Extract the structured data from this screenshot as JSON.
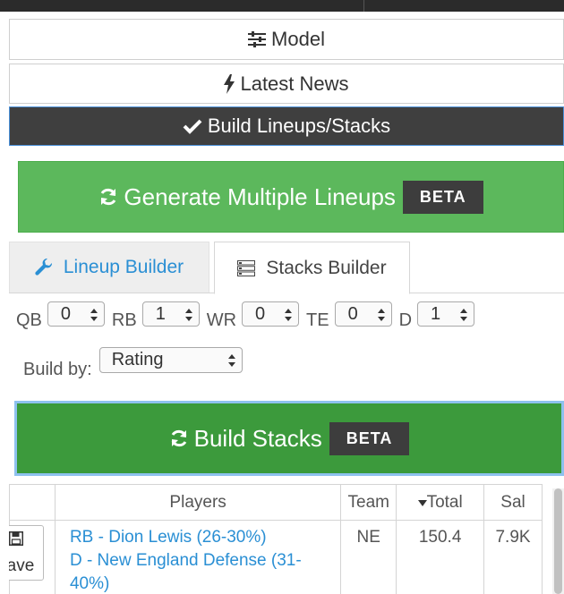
{
  "menu": {
    "model": "Model",
    "latest_news": "Latest News",
    "build": "Build Lineups/Stacks"
  },
  "generate": {
    "label": "Generate Multiple Lineups",
    "badge": "BETA"
  },
  "tabs": {
    "lineup": "Lineup Builder",
    "stacks": "Stacks Builder"
  },
  "positions": [
    {
      "label": "QB",
      "value": "0"
    },
    {
      "label": "RB",
      "value": "1"
    },
    {
      "label": "WR",
      "value": "0"
    },
    {
      "label": "TE",
      "value": "0"
    },
    {
      "label": "D",
      "value": "1"
    }
  ],
  "build_by": {
    "label": "Build by:",
    "value": "Rating"
  },
  "build_stacks": {
    "label": "Build Stacks",
    "badge": "BETA"
  },
  "table": {
    "headers": {
      "players": "Players",
      "team": "Team",
      "total": "Total",
      "sal": "Sal"
    },
    "rows": [
      {
        "save": "Save",
        "player1": "RB - Dion Lewis (26-30%)",
        "player2": "D - New England Defense (31-40%)",
        "team": "NE",
        "total": "150.4",
        "sal": "7.9K"
      }
    ]
  },
  "colors": {
    "green": "#5cb85c",
    "dark_green": "#3a9a3a",
    "link_blue": "#2a8fd4",
    "dark_bar": "#3f3f3f"
  }
}
